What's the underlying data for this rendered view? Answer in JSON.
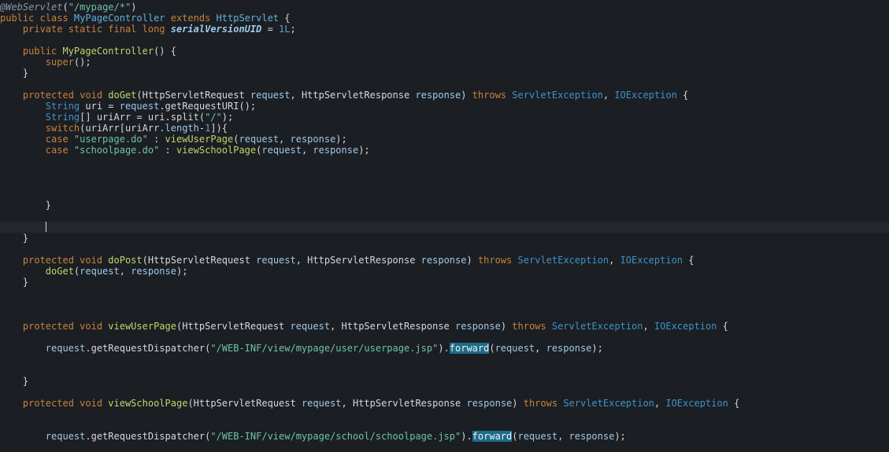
{
  "editor": {
    "theme_colors": {
      "background": "#1b1e23",
      "current_line": "#24272d",
      "plain": "#d6d8dc",
      "keyword": "#c8823b",
      "type": "#3f93c9",
      "class_name": "#5fb3d8",
      "method": "#c2d56e",
      "string": "#6ec4a5",
      "number": "#5fa3d9",
      "annotation": "#8d9aa6",
      "field": "#9fc9ea",
      "highlight_bg": "#1e6c86"
    },
    "current_line_index": 20,
    "lines": [
      {
        "tokens": [
          {
            "t": "@WebServlet",
            "c": "annotation",
            "i": true
          },
          {
            "t": "(",
            "c": "plain"
          },
          {
            "t": "\"/mypage/*\"",
            "c": "string"
          },
          {
            "t": ")",
            "c": "plain"
          }
        ]
      },
      {
        "tokens": [
          {
            "t": "public class ",
            "c": "keyword"
          },
          {
            "t": "MyPageController",
            "c": "class_name"
          },
          {
            "t": " extends ",
            "c": "keyword"
          },
          {
            "t": "HttpServlet",
            "c": "class_name"
          },
          {
            "t": " {",
            "c": "plain"
          }
        ]
      },
      {
        "tokens": [
          {
            "t": "    private static final long ",
            "c": "keyword"
          },
          {
            "t": "serialVersionUID",
            "c": "field",
            "i": true,
            "b": true
          },
          {
            "t": " = ",
            "c": "plain"
          },
          {
            "t": "1L",
            "c": "number"
          },
          {
            "t": ";",
            "c": "plain"
          }
        ]
      },
      {
        "tokens": []
      },
      {
        "tokens": [
          {
            "t": "    public ",
            "c": "keyword"
          },
          {
            "t": "MyPageController",
            "c": "method"
          },
          {
            "t": "() {",
            "c": "plain"
          }
        ]
      },
      {
        "tokens": [
          {
            "t": "        ",
            "c": "plain"
          },
          {
            "t": "super",
            "c": "keyword"
          },
          {
            "t": "();",
            "c": "plain"
          }
        ]
      },
      {
        "tokens": [
          {
            "t": "    }",
            "c": "plain"
          }
        ]
      },
      {
        "tokens": []
      },
      {
        "tokens": [
          {
            "t": "    protected void ",
            "c": "keyword"
          },
          {
            "t": "doGet",
            "c": "method"
          },
          {
            "t": "(",
            "c": "plain"
          },
          {
            "t": "HttpServletRequest",
            "c": "plain"
          },
          {
            "t": " request",
            "c": "field"
          },
          {
            "t": ", ",
            "c": "plain"
          },
          {
            "t": "HttpServletResponse",
            "c": "plain"
          },
          {
            "t": " response",
            "c": "field"
          },
          {
            "t": ") ",
            "c": "plain"
          },
          {
            "t": "throws ",
            "c": "keyword"
          },
          {
            "t": "ServletException",
            "c": "type"
          },
          {
            "t": ", ",
            "c": "plain"
          },
          {
            "t": "IOException",
            "c": "type"
          },
          {
            "t": " {",
            "c": "plain"
          }
        ]
      },
      {
        "tokens": [
          {
            "t": "        ",
            "c": "plain"
          },
          {
            "t": "String",
            "c": "type"
          },
          {
            "t": " uri = ",
            "c": "plain"
          },
          {
            "t": "request",
            "c": "field"
          },
          {
            "t": ".getRequestURI();",
            "c": "plain"
          }
        ]
      },
      {
        "tokens": [
          {
            "t": "        ",
            "c": "plain"
          },
          {
            "t": "String",
            "c": "type"
          },
          {
            "t": "[] uriArr = uri.split(",
            "c": "plain"
          },
          {
            "t": "\"/\"",
            "c": "string"
          },
          {
            "t": ");",
            "c": "plain"
          }
        ]
      },
      {
        "tokens": [
          {
            "t": "        ",
            "c": "plain"
          },
          {
            "t": "switch",
            "c": "keyword"
          },
          {
            "t": "(uriArr[uriArr.",
            "c": "plain"
          },
          {
            "t": "length",
            "c": "field"
          },
          {
            "t": "-",
            "c": "plain"
          },
          {
            "t": "1",
            "c": "number"
          },
          {
            "t": "]){",
            "c": "plain"
          }
        ]
      },
      {
        "tokens": [
          {
            "t": "        ",
            "c": "plain"
          },
          {
            "t": "case ",
            "c": "keyword"
          },
          {
            "t": "\"userpage.do\"",
            "c": "string"
          },
          {
            "t": " : ",
            "c": "plain"
          },
          {
            "t": "viewUserPage",
            "c": "method"
          },
          {
            "t": "(",
            "c": "plain"
          },
          {
            "t": "request",
            "c": "field"
          },
          {
            "t": ", ",
            "c": "plain"
          },
          {
            "t": "response",
            "c": "field"
          },
          {
            "t": ");",
            "c": "plain"
          }
        ]
      },
      {
        "tokens": [
          {
            "t": "        ",
            "c": "plain"
          },
          {
            "t": "case ",
            "c": "keyword"
          },
          {
            "t": "\"schoolpage.do\"",
            "c": "string"
          },
          {
            "t": " : ",
            "c": "plain"
          },
          {
            "t": "viewSchoolPage",
            "c": "method"
          },
          {
            "t": "(",
            "c": "plain"
          },
          {
            "t": "request",
            "c": "field"
          },
          {
            "t": ", ",
            "c": "plain"
          },
          {
            "t": "response",
            "c": "field"
          },
          {
            "t": ");",
            "c": "plain"
          }
        ]
      },
      {
        "tokens": []
      },
      {
        "tokens": []
      },
      {
        "tokens": []
      },
      {
        "tokens": []
      },
      {
        "tokens": [
          {
            "t": "        }",
            "c": "plain"
          }
        ]
      },
      {
        "tokens": []
      },
      {
        "tokens": [
          {
            "t": "        ",
            "c": "plain"
          }
        ],
        "caret": true
      },
      {
        "tokens": [
          {
            "t": "    }",
            "c": "plain"
          }
        ]
      },
      {
        "tokens": []
      },
      {
        "tokens": [
          {
            "t": "    protected void ",
            "c": "keyword"
          },
          {
            "t": "doPost",
            "c": "method"
          },
          {
            "t": "(",
            "c": "plain"
          },
          {
            "t": "HttpServletRequest",
            "c": "plain"
          },
          {
            "t": " request",
            "c": "field"
          },
          {
            "t": ", ",
            "c": "plain"
          },
          {
            "t": "HttpServletResponse",
            "c": "plain"
          },
          {
            "t": " response",
            "c": "field"
          },
          {
            "t": ") ",
            "c": "plain"
          },
          {
            "t": "throws ",
            "c": "keyword"
          },
          {
            "t": "ServletException",
            "c": "type"
          },
          {
            "t": ", ",
            "c": "plain"
          },
          {
            "t": "IOException",
            "c": "type"
          },
          {
            "t": " {",
            "c": "plain"
          }
        ]
      },
      {
        "tokens": [
          {
            "t": "        ",
            "c": "plain"
          },
          {
            "t": "doGet",
            "c": "method"
          },
          {
            "t": "(",
            "c": "plain"
          },
          {
            "t": "request",
            "c": "field"
          },
          {
            "t": ", ",
            "c": "plain"
          },
          {
            "t": "response",
            "c": "field"
          },
          {
            "t": ");",
            "c": "plain"
          }
        ]
      },
      {
        "tokens": [
          {
            "t": "    }",
            "c": "plain"
          }
        ]
      },
      {
        "tokens": []
      },
      {
        "tokens": []
      },
      {
        "tokens": []
      },
      {
        "tokens": [
          {
            "t": "    protected void ",
            "c": "keyword"
          },
          {
            "t": "viewUserPage",
            "c": "method"
          },
          {
            "t": "(",
            "c": "plain"
          },
          {
            "t": "HttpServletRequest",
            "c": "plain"
          },
          {
            "t": " request",
            "c": "field"
          },
          {
            "t": ", ",
            "c": "plain"
          },
          {
            "t": "HttpServletResponse",
            "c": "plain"
          },
          {
            "t": " response",
            "c": "field"
          },
          {
            "t": ") ",
            "c": "plain"
          },
          {
            "t": "throws ",
            "c": "keyword"
          },
          {
            "t": "ServletException",
            "c": "type"
          },
          {
            "t": ", ",
            "c": "plain"
          },
          {
            "t": "IOException",
            "c": "type"
          },
          {
            "t": " {",
            "c": "plain"
          }
        ]
      },
      {
        "tokens": []
      },
      {
        "tokens": [
          {
            "t": "        ",
            "c": "plain"
          },
          {
            "t": "request",
            "c": "field"
          },
          {
            "t": ".getRequestDispatcher(",
            "c": "plain"
          },
          {
            "t": "\"/WEB-INF/view/mypage/user/userpage.jsp\"",
            "c": "string"
          },
          {
            "t": ").",
            "c": "plain"
          },
          {
            "t": "forward",
            "c": "method",
            "h": true
          },
          {
            "t": "(",
            "c": "plain"
          },
          {
            "t": "request",
            "c": "field"
          },
          {
            "t": ", ",
            "c": "plain"
          },
          {
            "t": "response",
            "c": "field"
          },
          {
            "t": ");",
            "c": "plain"
          }
        ]
      },
      {
        "tokens": []
      },
      {
        "tokens": []
      },
      {
        "tokens": [
          {
            "t": "    }",
            "c": "plain"
          }
        ]
      },
      {
        "tokens": []
      },
      {
        "tokens": [
          {
            "t": "    protected void ",
            "c": "keyword"
          },
          {
            "t": "viewSchoolPage",
            "c": "method"
          },
          {
            "t": "(",
            "c": "plain"
          },
          {
            "t": "HttpServletRequest",
            "c": "plain"
          },
          {
            "t": " request",
            "c": "field"
          },
          {
            "t": ", ",
            "c": "plain"
          },
          {
            "t": "HttpServletResponse",
            "c": "plain"
          },
          {
            "t": " response",
            "c": "field"
          },
          {
            "t": ") ",
            "c": "plain"
          },
          {
            "t": "throws ",
            "c": "keyword"
          },
          {
            "t": "ServletException",
            "c": "type"
          },
          {
            "t": ", ",
            "c": "plain"
          },
          {
            "t": "IOException",
            "c": "type"
          },
          {
            "t": " {",
            "c": "plain"
          }
        ]
      },
      {
        "tokens": []
      },
      {
        "tokens": []
      },
      {
        "tokens": [
          {
            "t": "        ",
            "c": "plain"
          },
          {
            "t": "request",
            "c": "field"
          },
          {
            "t": ".getRequestDispatcher(",
            "c": "plain"
          },
          {
            "t": "\"/WEB-INF/view/mypage/school/schoolpage.jsp\"",
            "c": "string"
          },
          {
            "t": ").",
            "c": "plain"
          },
          {
            "t": "forward",
            "c": "method",
            "h": true
          },
          {
            "t": "(",
            "c": "plain"
          },
          {
            "t": "request",
            "c": "field"
          },
          {
            "t": ", ",
            "c": "plain"
          },
          {
            "t": "response",
            "c": "field"
          },
          {
            "t": ");",
            "c": "plain"
          }
        ]
      }
    ]
  }
}
